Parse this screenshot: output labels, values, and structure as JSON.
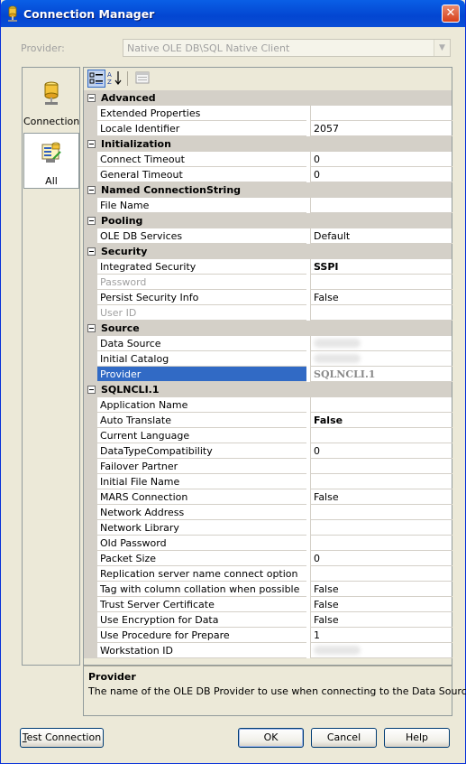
{
  "window": {
    "title": "Connection Manager",
    "close_glyph": "✕"
  },
  "provider": {
    "label": "Provider:",
    "value": "Native OLE DB\\SQL Native Client"
  },
  "nav": [
    {
      "label": "Connection",
      "icon": "database-icon"
    },
    {
      "label": "All",
      "icon": "property-list-icon"
    }
  ],
  "toolbar": {
    "categorized": "categorized-icon",
    "alphabetical": "sort-az-icon",
    "pages": "property-pages-icon"
  },
  "grid": [
    {
      "type": "cat",
      "label": "Advanced"
    },
    {
      "type": "prop",
      "name": "Extended Properties",
      "value": ""
    },
    {
      "type": "prop",
      "name": "Locale Identifier",
      "value": "2057"
    },
    {
      "type": "cat",
      "label": "Initialization"
    },
    {
      "type": "prop",
      "name": "Connect Timeout",
      "value": "0"
    },
    {
      "type": "prop",
      "name": "General Timeout",
      "value": "0"
    },
    {
      "type": "cat",
      "label": "Named ConnectionString"
    },
    {
      "type": "prop",
      "name": "File Name",
      "value": ""
    },
    {
      "type": "cat",
      "label": "Pooling"
    },
    {
      "type": "prop",
      "name": "OLE DB Services",
      "value": "Default"
    },
    {
      "type": "cat",
      "label": "Security"
    },
    {
      "type": "prop",
      "name": "Integrated Security",
      "value": "SSPI",
      "bold": true
    },
    {
      "type": "prop",
      "name": "Password",
      "value": "",
      "readonly": true
    },
    {
      "type": "prop",
      "name": "Persist Security Info",
      "value": "False"
    },
    {
      "type": "prop",
      "name": "User ID",
      "value": "",
      "readonly": true
    },
    {
      "type": "cat",
      "label": "Source"
    },
    {
      "type": "prop",
      "name": "Data Source",
      "value": "",
      "blurred": true
    },
    {
      "type": "prop",
      "name": "Initial Catalog",
      "value": "",
      "blurred": true
    },
    {
      "type": "prop",
      "name": "Provider",
      "value": "SQLNCLI.1",
      "selected": true
    },
    {
      "type": "cat",
      "label": "SQLNCLI.1"
    },
    {
      "type": "prop",
      "name": "Application Name",
      "value": ""
    },
    {
      "type": "prop",
      "name": "Auto Translate",
      "value": "False",
      "bold": true
    },
    {
      "type": "prop",
      "name": "Current Language",
      "value": ""
    },
    {
      "type": "prop",
      "name": "DataTypeCompatibility",
      "value": "0"
    },
    {
      "type": "prop",
      "name": "Failover Partner",
      "value": ""
    },
    {
      "type": "prop",
      "name": "Initial File Name",
      "value": ""
    },
    {
      "type": "prop",
      "name": "MARS Connection",
      "value": "False"
    },
    {
      "type": "prop",
      "name": "Network Address",
      "value": ""
    },
    {
      "type": "prop",
      "name": "Network Library",
      "value": ""
    },
    {
      "type": "prop",
      "name": "Old Password",
      "value": ""
    },
    {
      "type": "prop",
      "name": "Packet Size",
      "value": "0"
    },
    {
      "type": "prop",
      "name": "Replication server name connect option",
      "value": ""
    },
    {
      "type": "prop",
      "name": "Tag with column collation when possible",
      "value": "False"
    },
    {
      "type": "prop",
      "name": "Trust Server Certificate",
      "value": "False"
    },
    {
      "type": "prop",
      "name": "Use Encryption for Data",
      "value": "False"
    },
    {
      "type": "prop",
      "name": "Use Procedure for Prepare",
      "value": "1"
    },
    {
      "type": "prop",
      "name": "Workstation ID",
      "value": "",
      "blurred": true
    }
  ],
  "description": {
    "title": "Provider",
    "text": "The name of the OLE DB Provider to use when connecting to the Data Source."
  },
  "buttons": {
    "test_connection_u": "T",
    "test_connection_rest": "est Connection",
    "ok": "OK",
    "cancel": "Cancel",
    "help": "Help"
  },
  "colors": {
    "title_bar": "#0a5fe6",
    "selection": "#316ac5",
    "category": "#d4d0c8"
  }
}
